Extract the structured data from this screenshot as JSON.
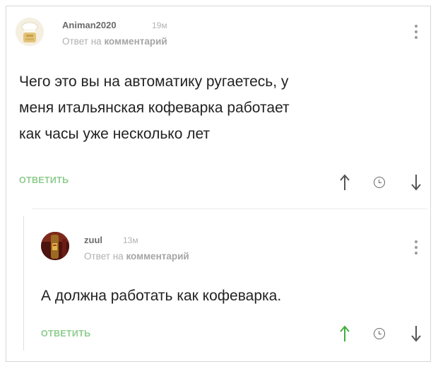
{
  "comments": [
    {
      "username": "Animan2020",
      "time": "19м",
      "reply_prefix": "Ответ на",
      "reply_target": "комментарий",
      "text_lines": [
        "Чего это вы на автоматику ругаетесь, у",
        "меня итальянская кофеварка работает",
        "как часы уже несколько лет"
      ],
      "reply_label": "ОТВЕТИТЬ",
      "upvote_active": false
    },
    {
      "username": "zuul",
      "time": "13м",
      "reply_prefix": "Ответ на",
      "reply_target": "комментарий",
      "text_lines": [
        "А должна работать как кофеварка."
      ],
      "reply_label": "ОТВЕТИТЬ",
      "upvote_active": true
    }
  ],
  "colors": {
    "reply_link": "#8fcc8f",
    "upvote_active": "#3fae3f",
    "vote_default": "#555555",
    "meta_text": "#b0b0b0"
  },
  "icons": [
    "avatar",
    "more-dots-icon",
    "upvote-arrow-icon",
    "clock-icon",
    "downvote-arrow-icon"
  ]
}
